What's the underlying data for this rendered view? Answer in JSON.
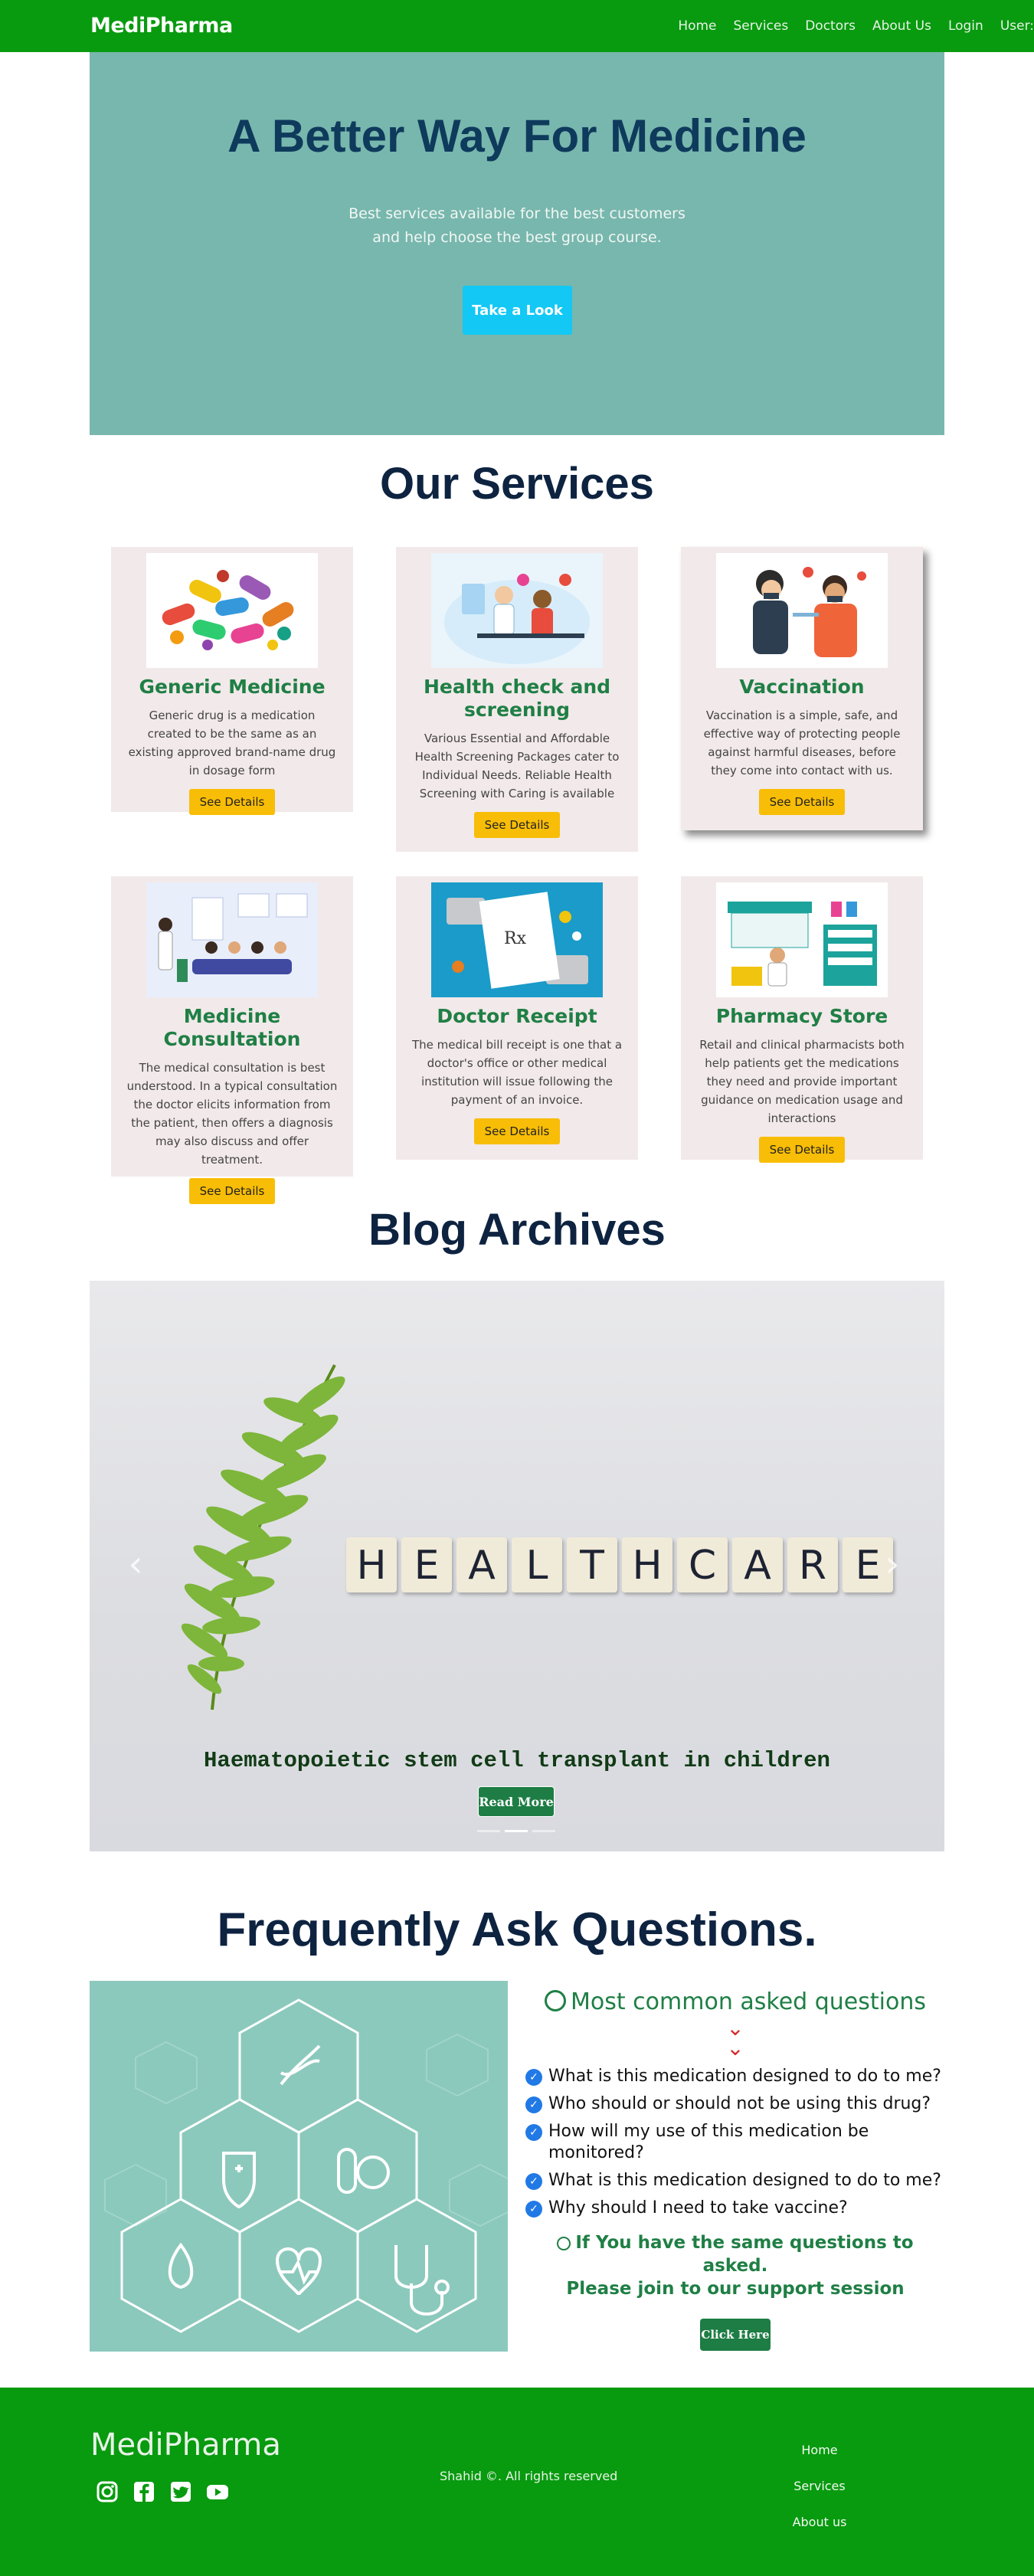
{
  "navbar": {
    "brand": "MediPharma",
    "links": [
      "Home",
      "Services",
      "Doctors",
      "About Us",
      "Login",
      "User:"
    ]
  },
  "hero": {
    "title": "A Better Way For Medicine",
    "subtitle_line1": "Best services available for the best customers",
    "subtitle_line2": "and help choose the best group course.",
    "button": "Take a Look",
    "bg_color": "#78b7ad"
  },
  "services": {
    "title": "Our Services",
    "details_label": "See Details",
    "cards": [
      {
        "title": "Generic Medicine",
        "text": "Generic drug is a medication created to be the same as an existing approved brand-name drug in dosage form"
      },
      {
        "title": "Health check and screening",
        "text": "Various Essential and Affordable Health Screening Packages cater to Individual Needs. Reliable Health Screening with Caring is available"
      },
      {
        "title": "Vaccination",
        "text": "Vaccination is a simple, safe, and effective way of protecting people against harmful diseases, before they come into contact with us."
      },
      {
        "title": "Medicine Consultation",
        "text": "The medical consultation is best understood. In a typical consultation the doctor elicits information from the patient, then offers a diagnosis may also discuss and offer treatment."
      },
      {
        "title": "Doctor Receipt",
        "text": "The medical bill receipt is one that a doctor's office or other medical institution will issue following the payment of an invoice."
      },
      {
        "title": "Pharmacy Store",
        "text": "Retail and clinical pharmacists both help patients get the medications they need and provide important guidance on medication usage and interactions"
      }
    ]
  },
  "blog": {
    "title": "Blog Archives",
    "image_word": "HEALTHCARE",
    "caption": "Haematopoietic stem cell transplant in children",
    "button": "Read More",
    "prev": "‹",
    "next": "›"
  },
  "faq": {
    "title": "Frequently Ask Questions.",
    "heading": "Most common asked questions",
    "questions": [
      "What is this medication designed to do to me?",
      "Who should or should not be using this drug?",
      "How will my use of this medication be monitored?",
      "What is this medication designed to do to me?",
      "Why should I need to take vaccine?"
    ],
    "join_line1": "If You have the same questions to asked.",
    "join_line2": "Please join to our support session",
    "button": "Click Here"
  },
  "footer": {
    "brand": "MediPharma",
    "copyright": "Shahid ©. All rights reserved",
    "links": [
      "Home",
      "Services",
      "About us"
    ],
    "socials": [
      "instagram-icon",
      "facebook-icon",
      "twitter-icon",
      "youtube-icon"
    ]
  },
  "colors": {
    "nav_green": "#089a0f",
    "title_navy": "#0d2340",
    "card_title_green": "#1f7f45",
    "button_yellow": "#f8bd06",
    "hero_button": "#13c8f5"
  }
}
